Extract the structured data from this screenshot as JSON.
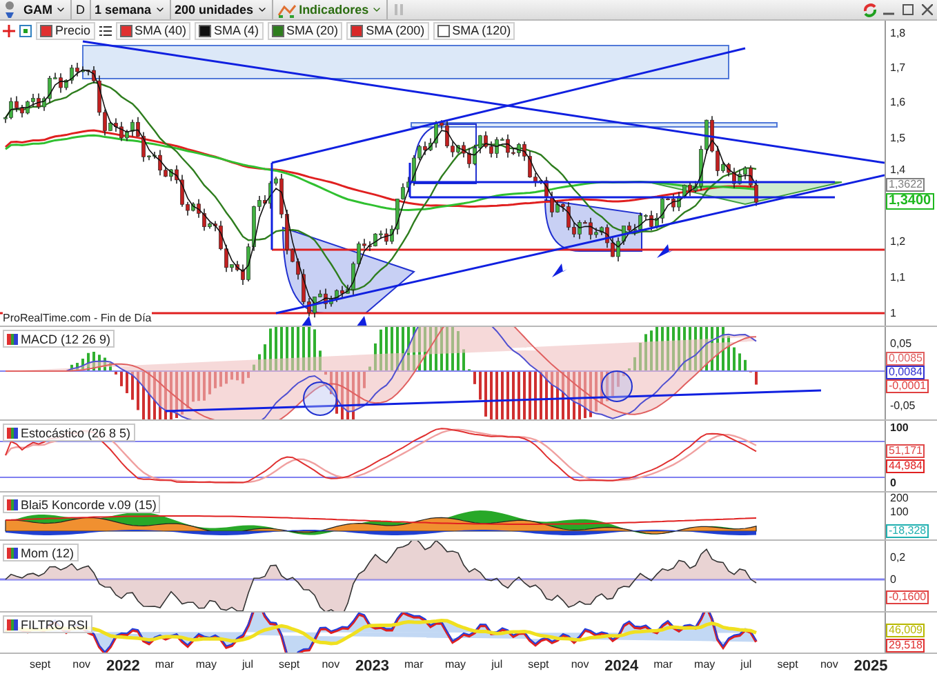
{
  "toolbar": {
    "symbol": "GAM",
    "mode_button": "D",
    "timeframe": "1 semana",
    "units": "200 unidades",
    "indicators": "Indicadores"
  },
  "legend": [
    {
      "label": "Precio",
      "color": "#e03030"
    },
    {
      "label": "SMA (40)",
      "color": "#e03030"
    },
    {
      "label": "SMA (4)",
      "color": "#101010"
    },
    {
      "label": "SMA (20)",
      "color": "#2e7d1e"
    },
    {
      "label": "SMA (200)",
      "color": "#d82828"
    },
    {
      "label": "SMA (120)",
      "color": "#ffffff"
    }
  ],
  "main_chart": {
    "ticks": [
      "1,8",
      "1,7",
      "1,6",
      "1,5",
      "1,4",
      "1,2",
      "1,1",
      "1"
    ],
    "badges": [
      {
        "text": "1,3622",
        "color": "#808080"
      },
      {
        "text": "1,3400",
        "color": "#1fb81f"
      }
    ],
    "source": "ProRealTime.com - Fin de Día"
  },
  "panels": [
    {
      "kind": "macd",
      "title": "MACD (12 26 9)",
      "ticks": [
        "0,05",
        "-0,05"
      ],
      "badges": [
        {
          "text": "0,0085",
          "color": "#e06060"
        },
        {
          "text": "0,0084",
          "color": "#3030d0"
        },
        {
          "text": "-0,0001",
          "color": "#e04040"
        }
      ]
    },
    {
      "kind": "stochastic",
      "title": "Estocástico (26 8 5)",
      "ticks": [
        "100",
        "0"
      ],
      "badges": [
        {
          "text": "51,171",
          "color": "#e04848"
        },
        {
          "text": "44,984",
          "color": "#e02020"
        }
      ]
    },
    {
      "kind": "koncorde",
      "title": "Blai5 Koncorde v.09 (15)",
      "ticks": [
        "200",
        "100"
      ],
      "badges": [
        {
          "text": "-18,328",
          "color": "#20b0b0"
        }
      ]
    },
    {
      "kind": "momentum",
      "title": "Mom (12)",
      "ticks": [
        "0,2",
        "0"
      ],
      "badges": [
        {
          "text": "-0,1600",
          "color": "#e04040"
        }
      ]
    },
    {
      "kind": "rsi",
      "title": "FILTRO RSI",
      "badges": [
        {
          "text": "46,009",
          "color": "#b8b800"
        },
        {
          "text": "29,518",
          "color": "#e03030"
        }
      ]
    }
  ],
  "x_axis": [
    {
      "label": "sept",
      "kind": "month"
    },
    {
      "label": "nov",
      "kind": "month"
    },
    {
      "label": "2022",
      "kind": "year"
    },
    {
      "label": "mar",
      "kind": "month"
    },
    {
      "label": "may",
      "kind": "month"
    },
    {
      "label": "jul",
      "kind": "month"
    },
    {
      "label": "sept",
      "kind": "month"
    },
    {
      "label": "nov",
      "kind": "month"
    },
    {
      "label": "2023",
      "kind": "year"
    },
    {
      "label": "mar",
      "kind": "month"
    },
    {
      "label": "may",
      "kind": "month"
    },
    {
      "label": "jul",
      "kind": "month"
    },
    {
      "label": "sept",
      "kind": "month"
    },
    {
      "label": "nov",
      "kind": "month"
    },
    {
      "label": "2024",
      "kind": "year"
    },
    {
      "label": "mar",
      "kind": "month"
    },
    {
      "label": "may",
      "kind": "month"
    },
    {
      "label": "jul",
      "kind": "month"
    },
    {
      "label": "sept",
      "kind": "month"
    },
    {
      "label": "nov",
      "kind": "month"
    },
    {
      "label": "2025",
      "kind": "year"
    }
  ]
}
